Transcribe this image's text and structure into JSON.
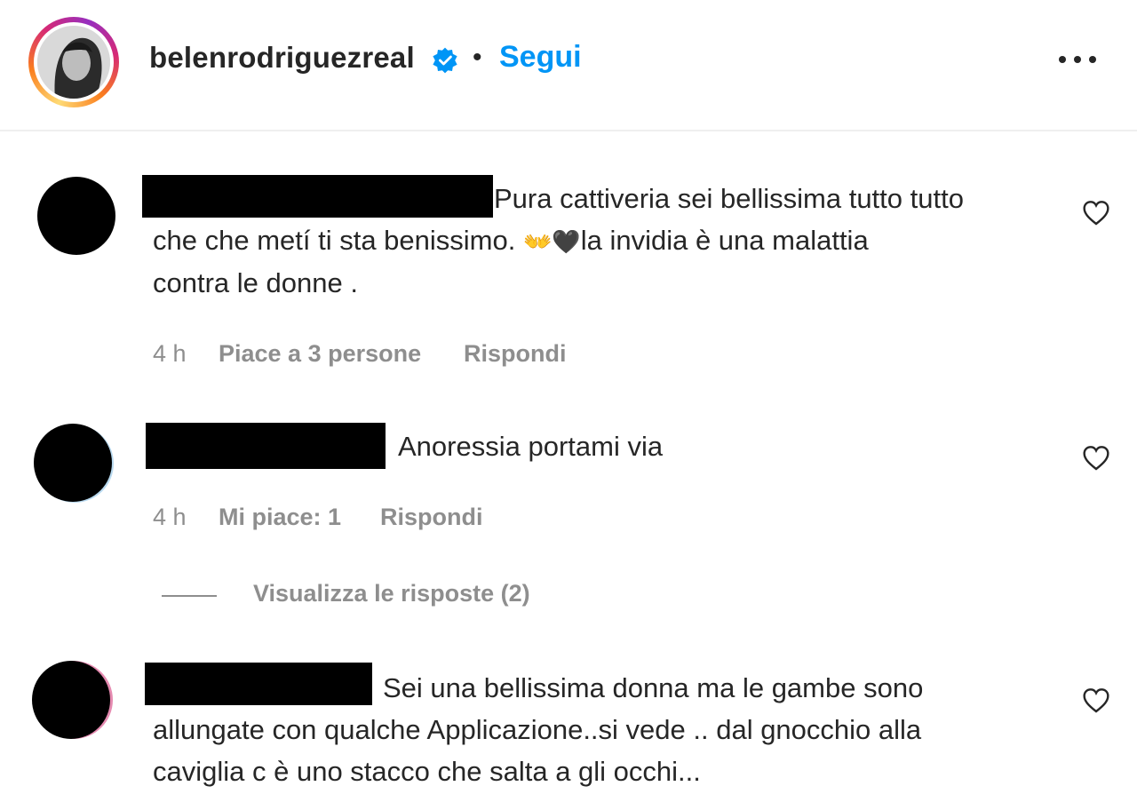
{
  "header": {
    "username": "belenrodriguezreal",
    "separator": "•",
    "follow_label": "Segui"
  },
  "comments": [
    {
      "text_line1": "Pura cattiveria sei bellissima tutto tutto",
      "text_line2_a": "che che metí ti sta benissimo. ",
      "emoji": "👐🖤",
      "text_line2_b": "la invidia è una malattia",
      "text_line3": "contra le donne .",
      "time": "4 h",
      "likes": "Piace a 3 persone",
      "reply": "Rispondi"
    },
    {
      "text_line1": "Anoressia portami via",
      "time": "4 h",
      "likes": "Mi piace: 1",
      "reply": "Rispondi",
      "view_replies": "Visualizza le risposte (2)"
    },
    {
      "text_line1": "Sei una bellissima donna ma le gambe sono",
      "text_line2": "allungate con qualche Applicazione..si vede .. dal gnocchio alla",
      "text_line3": "caviglia c è uno stacco che salta a gli occhi..."
    }
  ],
  "colors": {
    "accent": "#0095f6",
    "muted": "#8e8e8e",
    "text": "#262626"
  }
}
